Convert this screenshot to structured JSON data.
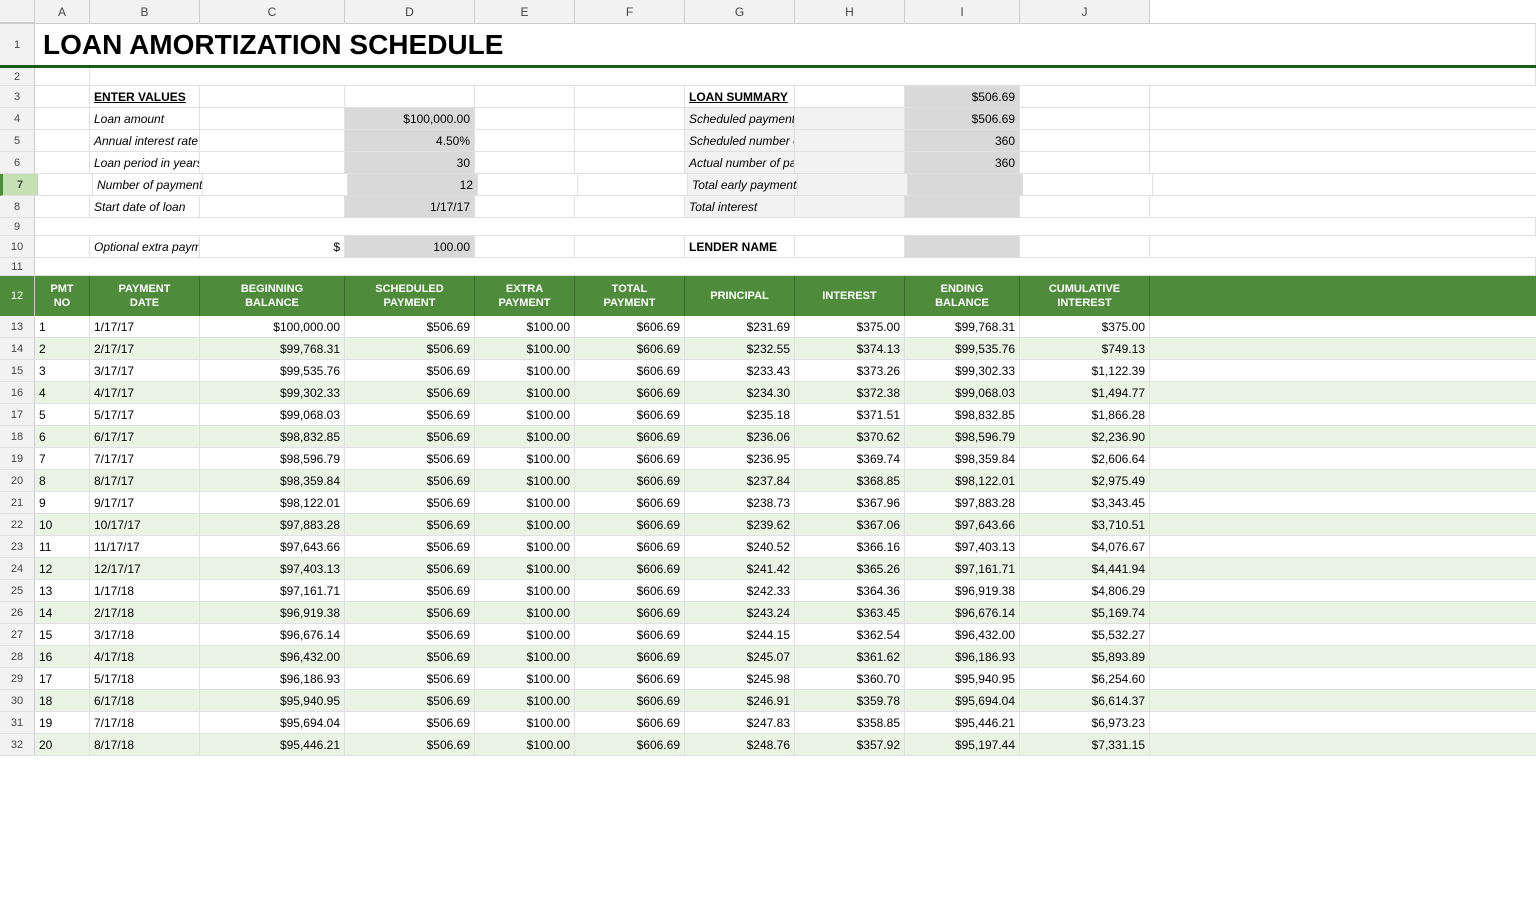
{
  "title": "LOAN AMORTIZATION SCHEDULE",
  "columns": [
    "A",
    "B",
    "C",
    "D",
    "E",
    "F",
    "G",
    "H",
    "I",
    "J"
  ],
  "enter_values": {
    "header": "ENTER VALUES",
    "fields": [
      {
        "label": "Loan amount",
        "value": "$100,000.00"
      },
      {
        "label": "Annual interest rate",
        "value": "4.50%"
      },
      {
        "label": "Loan period in years",
        "value": "30"
      },
      {
        "label": "Number of payments per year",
        "value": "12"
      },
      {
        "label": "Start date of loan",
        "value": "1/17/17"
      },
      {
        "label": "Optional extra payments",
        "prefix": "$",
        "value": "100.00"
      }
    ]
  },
  "loan_summary": {
    "header": "LOAN SUMMARY",
    "fields": [
      {
        "label": "Scheduled payment",
        "value": "$506.69"
      },
      {
        "label": "Scheduled number of payments",
        "value": "360"
      },
      {
        "label": "Actual number of payments",
        "value": "360"
      },
      {
        "label": "Total early payments",
        "value": ""
      },
      {
        "label": "Total interest",
        "value": ""
      }
    ],
    "lender_label": "LENDER NAME",
    "lender_value": ""
  },
  "table_headers": {
    "row1": [
      "PMT NO",
      "PAYMENT DATE",
      "BEGINNING BALANCE",
      "SCHEDULED PAYMENT",
      "EXTRA PAYMENT",
      "TOTAL PAYMENT",
      "PRINCIPAL",
      "INTEREST",
      "ENDING BALANCE",
      "CUMULATIVE INTEREST"
    ]
  },
  "data_rows": [
    {
      "no": 1,
      "date": "1/17/17",
      "beg": "$100,000.00",
      "sched": "$506.69",
      "extra": "$100.00",
      "total": "$606.69",
      "principal": "$231.69",
      "interest": "$375.00",
      "ending": "$99,768.31",
      "cum": "$375.00"
    },
    {
      "no": 2,
      "date": "2/17/17",
      "beg": "$99,768.31",
      "sched": "$506.69",
      "extra": "$100.00",
      "total": "$606.69",
      "principal": "$232.55",
      "interest": "$374.13",
      "ending": "$99,535.76",
      "cum": "$749.13"
    },
    {
      "no": 3,
      "date": "3/17/17",
      "beg": "$99,535.76",
      "sched": "$506.69",
      "extra": "$100.00",
      "total": "$606.69",
      "principal": "$233.43",
      "interest": "$373.26",
      "ending": "$99,302.33",
      "cum": "$1,122.39"
    },
    {
      "no": 4,
      "date": "4/17/17",
      "beg": "$99,302.33",
      "sched": "$506.69",
      "extra": "$100.00",
      "total": "$606.69",
      "principal": "$234.30",
      "interest": "$372.38",
      "ending": "$99,068.03",
      "cum": "$1,494.77"
    },
    {
      "no": 5,
      "date": "5/17/17",
      "beg": "$99,068.03",
      "sched": "$506.69",
      "extra": "$100.00",
      "total": "$606.69",
      "principal": "$235.18",
      "interest": "$371.51",
      "ending": "$98,832.85",
      "cum": "$1,866.28"
    },
    {
      "no": 6,
      "date": "6/17/17",
      "beg": "$98,832.85",
      "sched": "$506.69",
      "extra": "$100.00",
      "total": "$606.69",
      "principal": "$236.06",
      "interest": "$370.62",
      "ending": "$98,596.79",
      "cum": "$2,236.90"
    },
    {
      "no": 7,
      "date": "7/17/17",
      "beg": "$98,596.79",
      "sched": "$506.69",
      "extra": "$100.00",
      "total": "$606.69",
      "principal": "$236.95",
      "interest": "$369.74",
      "ending": "$98,359.84",
      "cum": "$2,606.64"
    },
    {
      "no": 8,
      "date": "8/17/17",
      "beg": "$98,359.84",
      "sched": "$506.69",
      "extra": "$100.00",
      "total": "$606.69",
      "principal": "$237.84",
      "interest": "$368.85",
      "ending": "$98,122.01",
      "cum": "$2,975.49"
    },
    {
      "no": 9,
      "date": "9/17/17",
      "beg": "$98,122.01",
      "sched": "$506.69",
      "extra": "$100.00",
      "total": "$606.69",
      "principal": "$238.73",
      "interest": "$367.96",
      "ending": "$97,883.28",
      "cum": "$3,343.45"
    },
    {
      "no": 10,
      "date": "10/17/17",
      "beg": "$97,883.28",
      "sched": "$506.69",
      "extra": "$100.00",
      "total": "$606.69",
      "principal": "$239.62",
      "interest": "$367.06",
      "ending": "$97,643.66",
      "cum": "$3,710.51"
    },
    {
      "no": 11,
      "date": "11/17/17",
      "beg": "$97,643.66",
      "sched": "$506.69",
      "extra": "$100.00",
      "total": "$606.69",
      "principal": "$240.52",
      "interest": "$366.16",
      "ending": "$97,403.13",
      "cum": "$4,076.67"
    },
    {
      "no": 12,
      "date": "12/17/17",
      "beg": "$97,403.13",
      "sched": "$506.69",
      "extra": "$100.00",
      "total": "$606.69",
      "principal": "$241.42",
      "interest": "$365.26",
      "ending": "$97,161.71",
      "cum": "$4,441.94"
    },
    {
      "no": 13,
      "date": "1/17/18",
      "beg": "$97,161.71",
      "sched": "$506.69",
      "extra": "$100.00",
      "total": "$606.69",
      "principal": "$242.33",
      "interest": "$364.36",
      "ending": "$96,919.38",
      "cum": "$4,806.29"
    },
    {
      "no": 14,
      "date": "2/17/18",
      "beg": "$96,919.38",
      "sched": "$506.69",
      "extra": "$100.00",
      "total": "$606.69",
      "principal": "$243.24",
      "interest": "$363.45",
      "ending": "$96,676.14",
      "cum": "$5,169.74"
    },
    {
      "no": 15,
      "date": "3/17/18",
      "beg": "$96,676.14",
      "sched": "$506.69",
      "extra": "$100.00",
      "total": "$606.69",
      "principal": "$244.15",
      "interest": "$362.54",
      "ending": "$96,432.00",
      "cum": "$5,532.27"
    },
    {
      "no": 16,
      "date": "4/17/18",
      "beg": "$96,432.00",
      "sched": "$506.69",
      "extra": "$100.00",
      "total": "$606.69",
      "principal": "$245.07",
      "interest": "$361.62",
      "ending": "$96,186.93",
      "cum": "$5,893.89"
    },
    {
      "no": 17,
      "date": "5/17/18",
      "beg": "$96,186.93",
      "sched": "$506.69",
      "extra": "$100.00",
      "total": "$606.69",
      "principal": "$245.98",
      "interest": "$360.70",
      "ending": "$95,940.95",
      "cum": "$6,254.60"
    },
    {
      "no": 18,
      "date": "6/17/18",
      "beg": "$95,940.95",
      "sched": "$506.69",
      "extra": "$100.00",
      "total": "$606.69",
      "principal": "$246.91",
      "interest": "$359.78",
      "ending": "$95,694.04",
      "cum": "$6,614.37"
    },
    {
      "no": 19,
      "date": "7/17/18",
      "beg": "$95,694.04",
      "sched": "$506.69",
      "extra": "$100.00",
      "total": "$606.69",
      "principal": "$247.83",
      "interest": "$358.85",
      "ending": "$95,446.21",
      "cum": "$6,973.23"
    },
    {
      "no": 20,
      "date": "8/17/18",
      "beg": "$95,446.21",
      "sched": "$506.69",
      "extra": "$100.00",
      "total": "$606.69",
      "principal": "$248.76",
      "interest": "$357.92",
      "ending": "$95,197.44",
      "cum": "$7,331.15"
    }
  ],
  "row_numbers": [
    1,
    2,
    3,
    4,
    5,
    6,
    7,
    8,
    9,
    10,
    11,
    12,
    13,
    14,
    15,
    16,
    17,
    18,
    19,
    20,
    21,
    22,
    23,
    24,
    25,
    26,
    27,
    28,
    29,
    30,
    31,
    32
  ]
}
